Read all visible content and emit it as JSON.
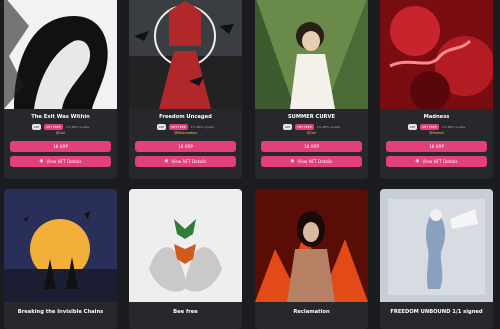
{
  "cards": [
    {
      "title": "The Exit Was Within",
      "type_badge": "ART",
      "holders_badge": "NFT FREE",
      "royalty": "1% 48% royalty",
      "creator": "@Cori",
      "price": "18 XRP",
      "view": "View NFT Details"
    },
    {
      "title": "Freedom Uncaged",
      "type_badge": "ART",
      "holders_badge": "NFT FREE",
      "royalty": "1% 48% royalty",
      "creator": "@Wildcreation",
      "price": "18 XRP",
      "view": "View NFT Details"
    },
    {
      "title": "SUMMER CURVE",
      "type_badge": "ART",
      "holders_badge": "NFT FREE",
      "royalty": "1% 48% royalty",
      "creator": "@Cori",
      "price": "18 XRP",
      "view": "View NFT Details"
    },
    {
      "title": "Madness",
      "type_badge": "ART",
      "holders_badge": "NFT FREE",
      "royalty": "1% 48% royalty",
      "creator": "@Muthell",
      "price": "18 XRP",
      "view": "View NFT Details"
    },
    {
      "title": "Breaking the Invisible Chains"
    },
    {
      "title": "Bee free"
    },
    {
      "title": "Reclamation"
    },
    {
      "title": "FREEDOM UNBOUND 1/1 signed"
    }
  ],
  "icons": {
    "view": "eye-icon"
  },
  "colors": {
    "accent": "#e23f7d",
    "card": "#26282d",
    "bg": "#1a1c20"
  }
}
